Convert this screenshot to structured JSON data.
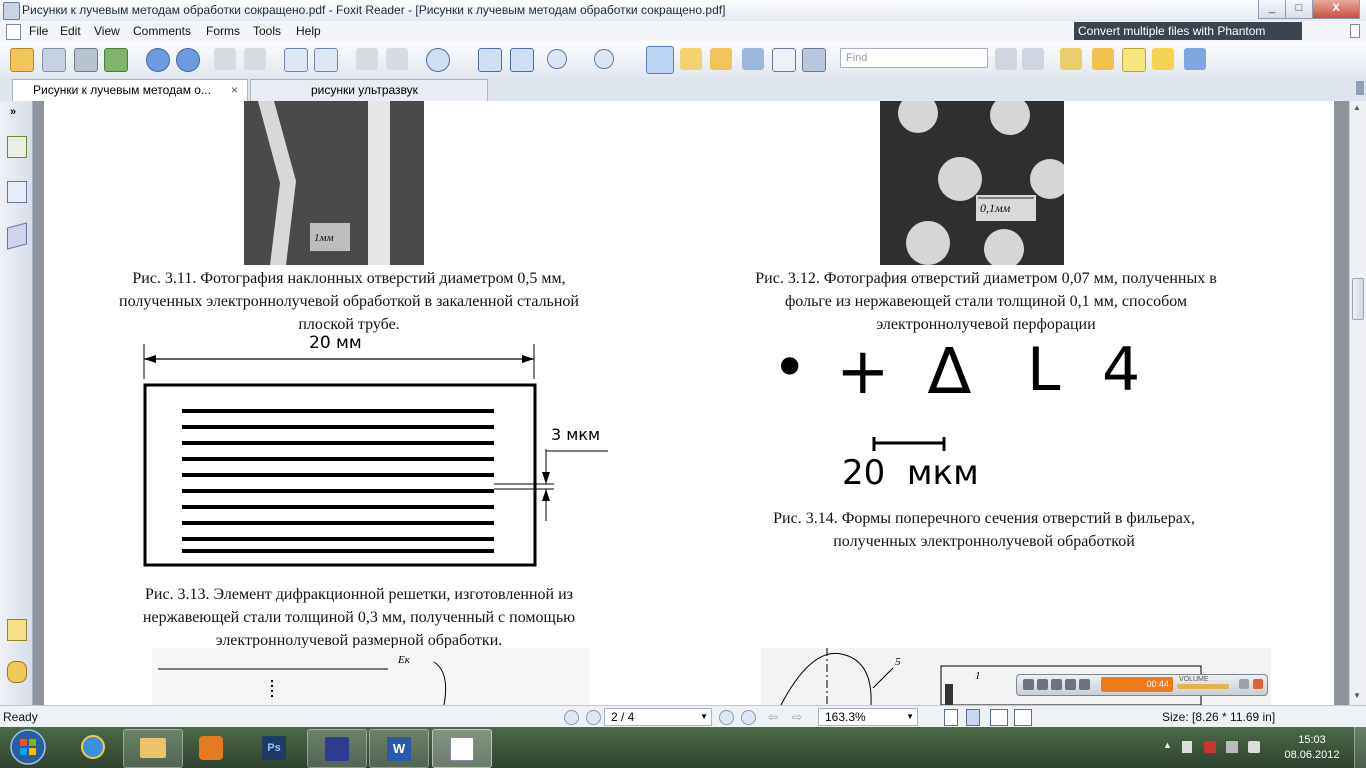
{
  "window": {
    "title": "Рисунки к лучевым методам обработки сокращено.pdf - Foxit Reader - [Рисунки к лучевым методам обработки сокращено.pdf]",
    "controls": [
      "_",
      "□",
      "X"
    ]
  },
  "menu": [
    "File",
    "Edit",
    "View",
    "Comments",
    "Forms",
    "Tools",
    "Help"
  ],
  "promo_text": "Convert multiple files with Phantom",
  "toolbar": {
    "find_placeholder": "Find"
  },
  "tabs": [
    {
      "label": "Рисунки к лучевым методам о...",
      "close": "×",
      "active": true
    },
    {
      "label": "рисунки ультразвук",
      "active": false
    }
  ],
  "sidebar_toggle": "»",
  "document": {
    "fig_3_11_caption": [
      "Рис. 3.11. Фотография наклонных отверстий диаметром 0,5 мм,",
      "полученных электроннолучевой обработкой в закаленной стальной",
      "плоской трубе."
    ],
    "fig_3_11_scale_label": "1мм",
    "fig_3_12_caption": [
      "Рис. 3.12. Фотография отверстий диаметром 0,07 мм, полученных в",
      "фольге из нержавеющей стали толщиной 0,1 мм, способом",
      "электроннолучевой перфорации"
    ],
    "fig_3_12_scale_label": "0,1мм",
    "fig_3_13_width_label": "20  мм",
    "fig_3_13_gap_label": "3  мкм",
    "fig_3_13_caption": [
      "Рис. 3.13. Элемент дифракционной решетки, изготовленной из",
      "нержавеющей стали толщиной 0,3 мм, полученный с помощью",
      "электроннолучевой размерной обработки."
    ],
    "fig_3_14_shapes": [
      "•",
      "+",
      "∆",
      "L",
      "4"
    ],
    "fig_3_14_scale_label": "20  мкм",
    "fig_3_14_caption": [
      "Рис. 3.14. Формы поперечного сечения отверстий в фильерах,",
      "полученных электроннолучевой обработкой"
    ],
    "fig_bottom_left_label": "Ек",
    "fig_bottom_right_labels": [
      "5",
      "1"
    ]
  },
  "status": {
    "ready": "Ready",
    "page_display": "2 / 4",
    "zoom": "163.3%",
    "size": "Size: [8.26 * 11.69 in]"
  },
  "media_player": {
    "time": "00:44",
    "volume_label": "VOLUME"
  },
  "taskbar": {
    "apps": [
      "internet-explorer",
      "file-explorer",
      "media-player",
      "photoshop",
      "save-app",
      "word",
      "foxit-reader"
    ],
    "time": "15:03",
    "date": "08.06.2012"
  }
}
